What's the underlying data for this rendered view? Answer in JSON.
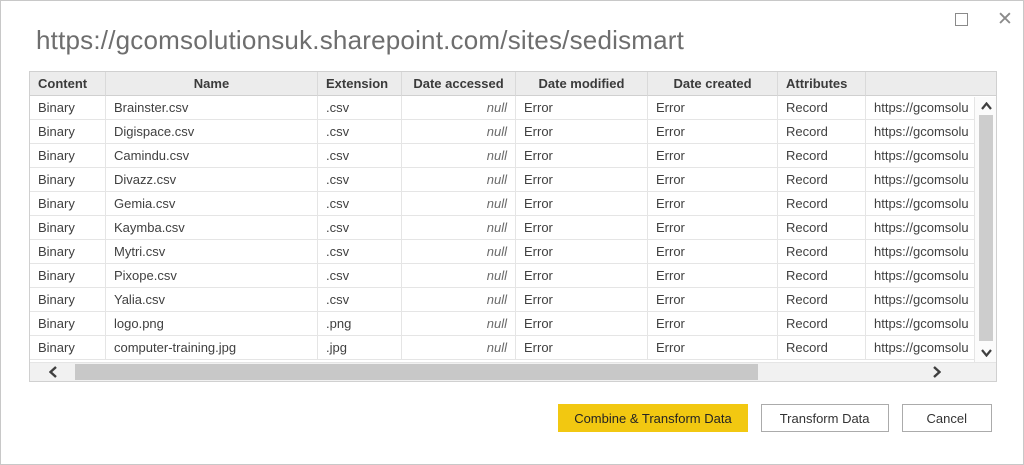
{
  "window": {
    "title": "https://gcomsolutionsuk.sharepoint.com/sites/sedismart"
  },
  "table": {
    "columns": [
      {
        "key": "content",
        "label": "Content"
      },
      {
        "key": "name",
        "label": "Name"
      },
      {
        "key": "extension",
        "label": "Extension"
      },
      {
        "key": "date_accessed",
        "label": "Date accessed"
      },
      {
        "key": "date_modified",
        "label": "Date modified"
      },
      {
        "key": "date_created",
        "label": "Date created"
      },
      {
        "key": "attributes",
        "label": "Attributes"
      },
      {
        "key": "url",
        "label": ""
      }
    ],
    "rows": [
      {
        "content": "Binary",
        "name": "Brainster.csv",
        "extension": ".csv",
        "date_accessed": "null",
        "date_modified": "Error",
        "date_created": "Error",
        "attributes": "Record",
        "url": "https://gcomsolu"
      },
      {
        "content": "Binary",
        "name": "Digispace.csv",
        "extension": ".csv",
        "date_accessed": "null",
        "date_modified": "Error",
        "date_created": "Error",
        "attributes": "Record",
        "url": "https://gcomsolu"
      },
      {
        "content": "Binary",
        "name": "Camindu.csv",
        "extension": ".csv",
        "date_accessed": "null",
        "date_modified": "Error",
        "date_created": "Error",
        "attributes": "Record",
        "url": "https://gcomsolu"
      },
      {
        "content": "Binary",
        "name": "Divazz.csv",
        "extension": ".csv",
        "date_accessed": "null",
        "date_modified": "Error",
        "date_created": "Error",
        "attributes": "Record",
        "url": "https://gcomsolu"
      },
      {
        "content": "Binary",
        "name": "Gemia.csv",
        "extension": ".csv",
        "date_accessed": "null",
        "date_modified": "Error",
        "date_created": "Error",
        "attributes": "Record",
        "url": "https://gcomsolu"
      },
      {
        "content": "Binary",
        "name": "Kaymba.csv",
        "extension": ".csv",
        "date_accessed": "null",
        "date_modified": "Error",
        "date_created": "Error",
        "attributes": "Record",
        "url": "https://gcomsolu"
      },
      {
        "content": "Binary",
        "name": "Mytri.csv",
        "extension": ".csv",
        "date_accessed": "null",
        "date_modified": "Error",
        "date_created": "Error",
        "attributes": "Record",
        "url": "https://gcomsolu"
      },
      {
        "content": "Binary",
        "name": "Pixope.csv",
        "extension": ".csv",
        "date_accessed": "null",
        "date_modified": "Error",
        "date_created": "Error",
        "attributes": "Record",
        "url": "https://gcomsolu"
      },
      {
        "content": "Binary",
        "name": "Yalia.csv",
        "extension": ".csv",
        "date_accessed": "null",
        "date_modified": "Error",
        "date_created": "Error",
        "attributes": "Record",
        "url": "https://gcomsolu"
      },
      {
        "content": "Binary",
        "name": "logo.png",
        "extension": ".png",
        "date_accessed": "null",
        "date_modified": "Error",
        "date_created": "Error",
        "attributes": "Record",
        "url": "https://gcomsolu"
      },
      {
        "content": "Binary",
        "name": "computer-training.jpg",
        "extension": ".jpg",
        "date_accessed": "null",
        "date_modified": "Error",
        "date_created": "Error",
        "attributes": "Record",
        "url": "https://gcomsolu"
      }
    ]
  },
  "footer": {
    "combine_label": "Combine & Transform Data",
    "transform_label": "Transform Data",
    "cancel_label": "Cancel"
  },
  "colors": {
    "accent_yellow": "#f2c811",
    "title_gray": "#6e6e6e"
  }
}
